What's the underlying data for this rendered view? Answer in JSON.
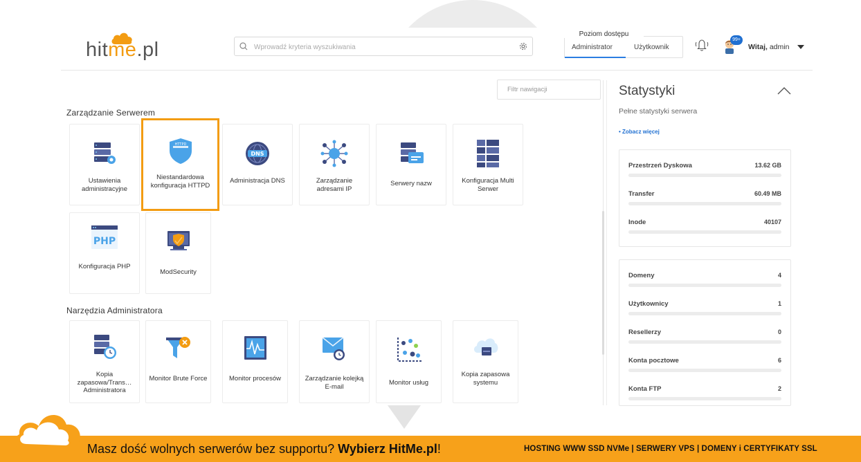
{
  "header": {
    "logo": {
      "part1": "hit",
      "part2": "me",
      "part3": ".pl"
    },
    "search_placeholder": "Wprowadź kryteria wyszukiwania",
    "access_title": "Poziom dostępu",
    "access_tabs": [
      "Administrator",
      "Użytkownik"
    ],
    "notif_badge": "99+",
    "greeting_bold": "Witaj,",
    "greeting_user": " admin"
  },
  "filter": {
    "placeholder": "Filtr nawigacji"
  },
  "sections": [
    {
      "title": "Zarządzanie Serwerem",
      "cards": [
        {
          "label": "Ustawienia administracyjne",
          "icon": "server-gear-icon"
        },
        {
          "label": "Niestandardowa konfiguracja HTTPD",
          "icon": "httpd-shield-icon"
        },
        {
          "label": "Administracja DNS",
          "icon": "dns-globe-icon"
        },
        {
          "label": "Zarządzanie adresami IP",
          "icon": "ip-network-icon"
        },
        {
          "label": "Serwery nazw",
          "icon": "nameserver-icon"
        },
        {
          "label": "Konfiguracja Multi Serwer",
          "icon": "multi-server-icon"
        },
        {
          "label": "Konfiguracja PHP",
          "icon": "php-icon"
        },
        {
          "label": "ModSecurity",
          "icon": "modsecurity-icon"
        }
      ]
    },
    {
      "title": "Narzędzia Administratora",
      "cards": [
        {
          "label": "Kopia zapasowa/Trans… Administratora",
          "icon": "backup-clock-icon"
        },
        {
          "label": "Monitor Brute Force",
          "icon": "funnel-block-icon"
        },
        {
          "label": "Monitor procesów",
          "icon": "process-monitor-icon"
        },
        {
          "label": "Zarządzanie kolejką E-mail",
          "icon": "mail-queue-icon"
        },
        {
          "label": "Monitor usług",
          "icon": "service-chart-icon"
        },
        {
          "label": "Kopia zapasowa systemu",
          "icon": "cloud-backup-icon"
        }
      ]
    }
  ],
  "stats": {
    "title": "Statystyki",
    "subtitle": "Pełne statystyki serwera",
    "more_link": "• Zobacz więcej",
    "group1": [
      {
        "name": "Przestrzeń Dyskowa",
        "value": "13.62 GB"
      },
      {
        "name": "Transfer",
        "value": "60.49 MB"
      },
      {
        "name": "Inode",
        "value": "40107"
      }
    ],
    "group2": [
      {
        "name": "Domeny",
        "value": "4"
      },
      {
        "name": "Użytkownicy",
        "value": "1"
      },
      {
        "name": "Resellerzy",
        "value": "0"
      },
      {
        "name": "Konta pocztowe",
        "value": "6"
      },
      {
        "name": "Konta FTP",
        "value": "2"
      }
    ]
  },
  "banner": {
    "text_main": "Masz dość wolnych serwerów bez supportu? ",
    "text_bold": "Wybierz HitMe.pl",
    "text_end": "!",
    "right": "HOSTING WWW SSD NVMe | SERWERY VPS | DOMENY i CERTYFIKATY SSL"
  },
  "colors": {
    "accent": "#f39c12",
    "blue": "#2a7de1",
    "banner": "#f7a11a"
  }
}
